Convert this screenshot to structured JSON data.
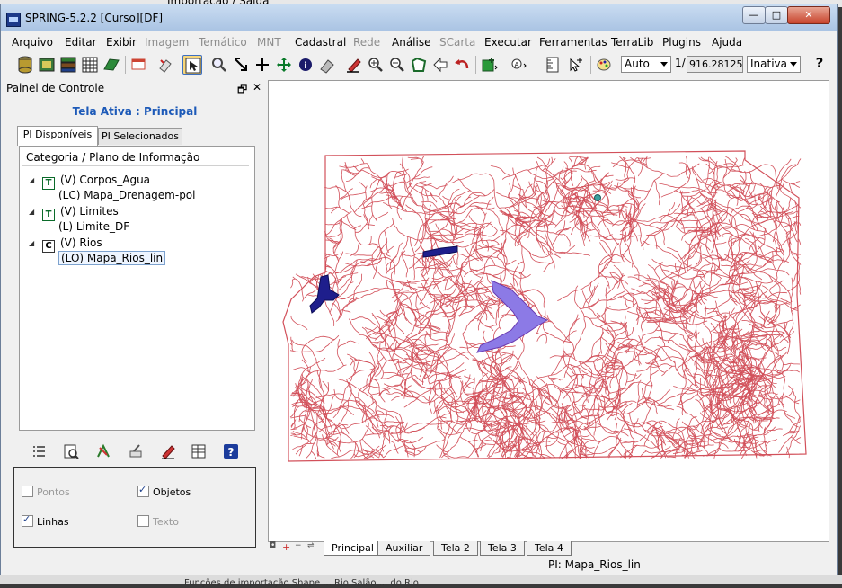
{
  "background": {
    "top_text": "Importação / Saída",
    "bottom_text": "Funções de importação Shape ... Rio Salão ... do Rio"
  },
  "window": {
    "title": "SPRING-5.2.2 [Curso][DF]",
    "controls": {
      "minimize": "—",
      "maximize": "□",
      "close": "✕"
    }
  },
  "menu": [
    {
      "label": "Arquivo",
      "enabled": true
    },
    {
      "label": "Editar",
      "enabled": true
    },
    {
      "label": "Exibir",
      "enabled": true
    },
    {
      "label": "Imagem",
      "enabled": false
    },
    {
      "label": "Temático",
      "enabled": false
    },
    {
      "label": "MNT",
      "enabled": false
    },
    {
      "label": "Cadastral",
      "enabled": true
    },
    {
      "label": "Rede",
      "enabled": false
    },
    {
      "label": "Análise",
      "enabled": true
    },
    {
      "label": "SCarta",
      "enabled": false
    },
    {
      "label": "Executar",
      "enabled": true
    },
    {
      "label": "Ferramentas",
      "enabled": true
    },
    {
      "label": "TerraLib",
      "enabled": true
    },
    {
      "label": "Plugins",
      "enabled": true
    },
    {
      "label": "Ajuda",
      "enabled": true
    }
  ],
  "toolbar": {
    "icons": [
      "database-icon",
      "image-layers-icon",
      "stack-layers-icon",
      "grid-icon",
      "polygon-icon",
      "window-icon",
      "eraser-icon",
      "cursor-pointer-icon",
      "magnifier-icon",
      "select-area-icon",
      "crosshair-icon",
      "pan-icon",
      "info-icon",
      "edit-tool-icon",
      "pencil-icon",
      "zoom-in-icon",
      "zoom-out-icon",
      "zoom-window-icon",
      "previous-view-icon",
      "undo-icon",
      "layer-add-icon",
      "view-scale-icon",
      "ruler-icon",
      "pointer-plus-icon",
      "palette-icon"
    ],
    "zoom_mode": "Auto",
    "scale_prefix": "1/",
    "scale_value": "916.281250",
    "screen_state": "Inativa",
    "help": "?"
  },
  "panel": {
    "title": "Painel de Controle",
    "active_screen": "Tela Ativa : Principal",
    "tabs": [
      "PI Disponíveis",
      "PI Selecionados"
    ],
    "tree_header": "Categoria / Plano de Informação",
    "tree": [
      {
        "type": "T",
        "label": "(V) Corpos_Agua",
        "children": [
          "(LC) Mapa_Drenagem-pol"
        ]
      },
      {
        "type": "T",
        "label": "(V) Limites",
        "children": [
          "(L) Limite_DF"
        ]
      },
      {
        "type": "C",
        "label": "(V) Rios",
        "children": [
          "(LO) Mapa_Rios_lin"
        ]
      }
    ],
    "tools": [
      "list-icon",
      "visual-icon",
      "edit-objects-icon",
      "draw-icon",
      "pencil-icon",
      "table-icon",
      "help-icon"
    ],
    "options": [
      {
        "label": "Pontos",
        "checked": false,
        "enabled": false
      },
      {
        "label": "Objetos",
        "checked": true,
        "enabled": true
      },
      {
        "label": "Linhas",
        "checked": true,
        "enabled": true
      },
      {
        "label": "Texto",
        "checked": false,
        "enabled": false
      }
    ]
  },
  "screens": [
    "Principal",
    "Auxiliar",
    "Tela 2",
    "Tela 3",
    "Tela 4"
  ],
  "status": "PI: Mapa_Rios_lin",
  "colors": {
    "rivers": "#d2505a",
    "lake_dark": "#1e1e8c",
    "lake_light": "#8c7ae6",
    "link": "#1d5ab8"
  }
}
